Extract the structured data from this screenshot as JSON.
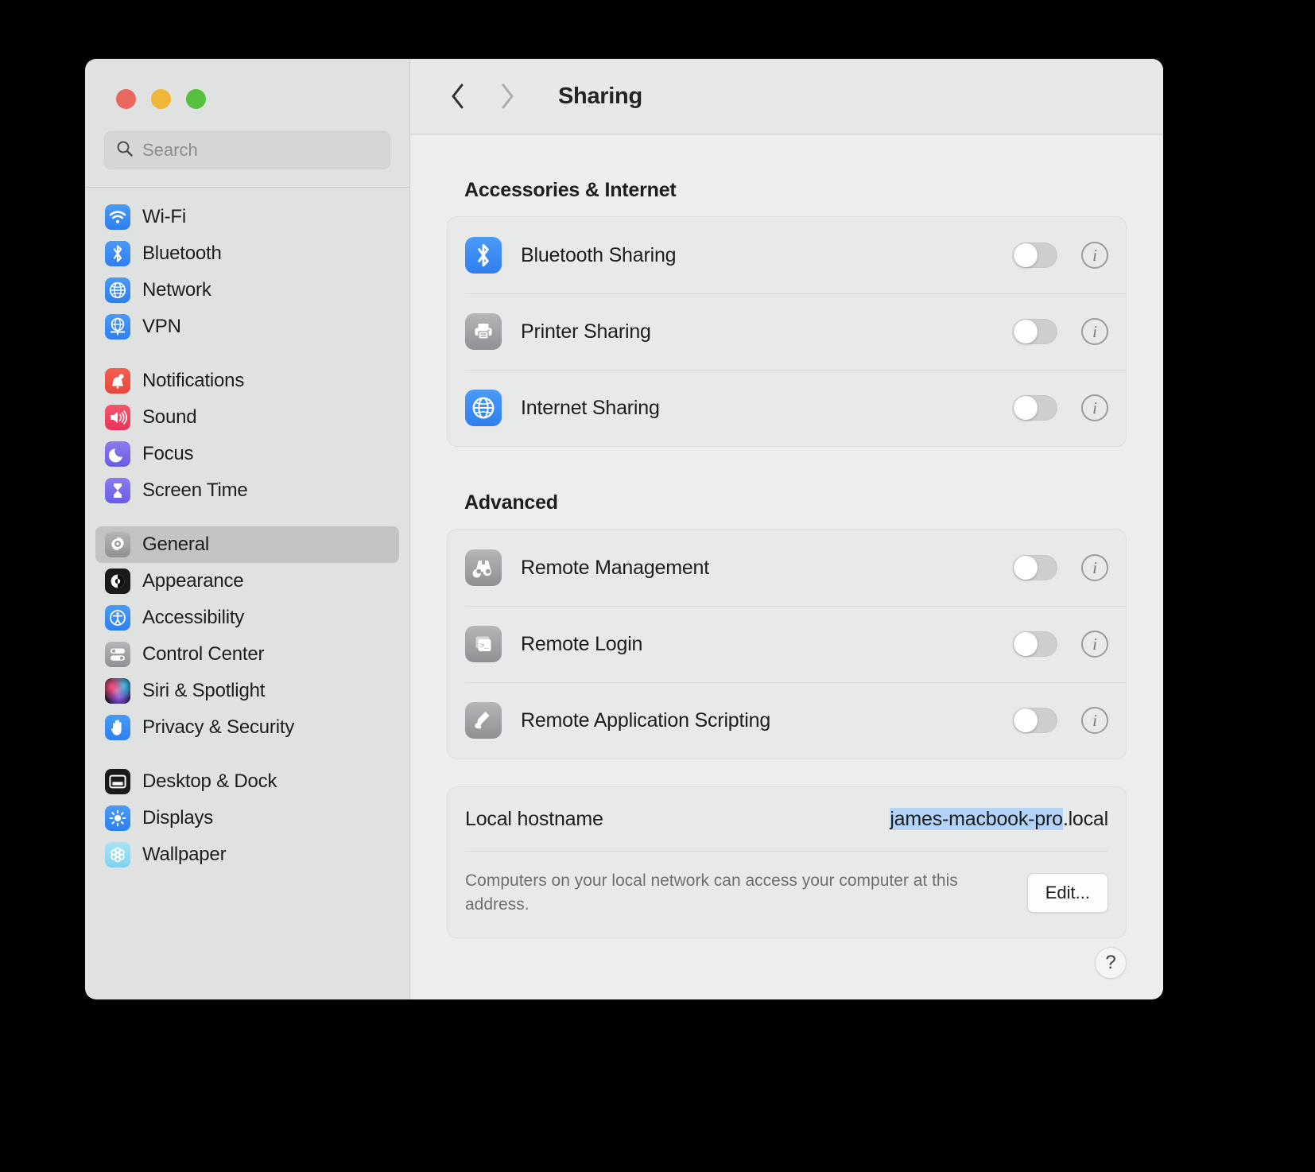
{
  "window": {
    "traffic_lights": [
      "close",
      "minimize",
      "zoom"
    ]
  },
  "sidebar": {
    "search": {
      "placeholder": "Search",
      "value": ""
    },
    "groups": [
      {
        "items": [
          {
            "label": "Wi-Fi",
            "icon": "wifi-icon",
            "selected": false
          },
          {
            "label": "Bluetooth",
            "icon": "bluetooth-icon",
            "selected": false
          },
          {
            "label": "Network",
            "icon": "globe-icon",
            "selected": false
          },
          {
            "label": "VPN",
            "icon": "vpn-globe-icon",
            "selected": false
          }
        ]
      },
      {
        "items": [
          {
            "label": "Notifications",
            "icon": "bell-icon",
            "selected": false
          },
          {
            "label": "Sound",
            "icon": "speaker-icon",
            "selected": false
          },
          {
            "label": "Focus",
            "icon": "moon-icon",
            "selected": false
          },
          {
            "label": "Screen Time",
            "icon": "hourglass-icon",
            "selected": false
          }
        ]
      },
      {
        "items": [
          {
            "label": "General",
            "icon": "gear-icon",
            "selected": true
          },
          {
            "label": "Appearance",
            "icon": "appearance-icon",
            "selected": false
          },
          {
            "label": "Accessibility",
            "icon": "accessibility-icon",
            "selected": false
          },
          {
            "label": "Control Center",
            "icon": "sliders-icon",
            "selected": false
          },
          {
            "label": "Siri & Spotlight",
            "icon": "siri-icon",
            "selected": false
          },
          {
            "label": "Privacy & Security",
            "icon": "hand-icon",
            "selected": false
          }
        ]
      },
      {
        "items": [
          {
            "label": "Desktop & Dock",
            "icon": "desktop-dock-icon",
            "selected": false
          },
          {
            "label": "Displays",
            "icon": "brightness-icon",
            "selected": false
          },
          {
            "label": "Wallpaper",
            "icon": "wallpaper-icon",
            "selected": false
          }
        ]
      }
    ]
  },
  "toolbar": {
    "back": "‹",
    "forward": "›",
    "title": "Sharing"
  },
  "main": {
    "sections": [
      {
        "title": "Accessories & Internet",
        "rows": [
          {
            "label": "Bluetooth Sharing",
            "icon": "bluetooth-icon",
            "icon_style": "g-blue",
            "enabled": false,
            "info": "i"
          },
          {
            "label": "Printer Sharing",
            "icon": "printer-icon",
            "icon_style": "g-gray",
            "enabled": false,
            "info": "i"
          },
          {
            "label": "Internet Sharing",
            "icon": "globe-icon",
            "icon_style": "g-blue",
            "enabled": false,
            "info": "i"
          }
        ]
      },
      {
        "title": "Advanced",
        "rows": [
          {
            "label": "Remote Management",
            "icon": "binoculars-icon",
            "icon_style": "g-gray",
            "enabled": false,
            "info": "i"
          },
          {
            "label": "Remote Login",
            "icon": "terminal-icon",
            "icon_style": "g-gray",
            "enabled": false,
            "info": "i"
          },
          {
            "label": "Remote Application Scripting",
            "icon": "script-icon",
            "icon_style": "g-gray",
            "enabled": false,
            "info": "i"
          }
        ]
      }
    ],
    "hostname": {
      "label": "Local hostname",
      "value_selected": "james-macbook-pro",
      "value_rest": ".local",
      "description": "Computers on your local network can access your computer at this address.",
      "edit_label": "Edit..."
    },
    "help_label": "?"
  },
  "colors": {
    "accent_blue": "#2f7ef0",
    "selection_blue": "#b4d4f7",
    "sidebar_bg": "#e0e2e2",
    "main_bg": "#eceeee"
  }
}
